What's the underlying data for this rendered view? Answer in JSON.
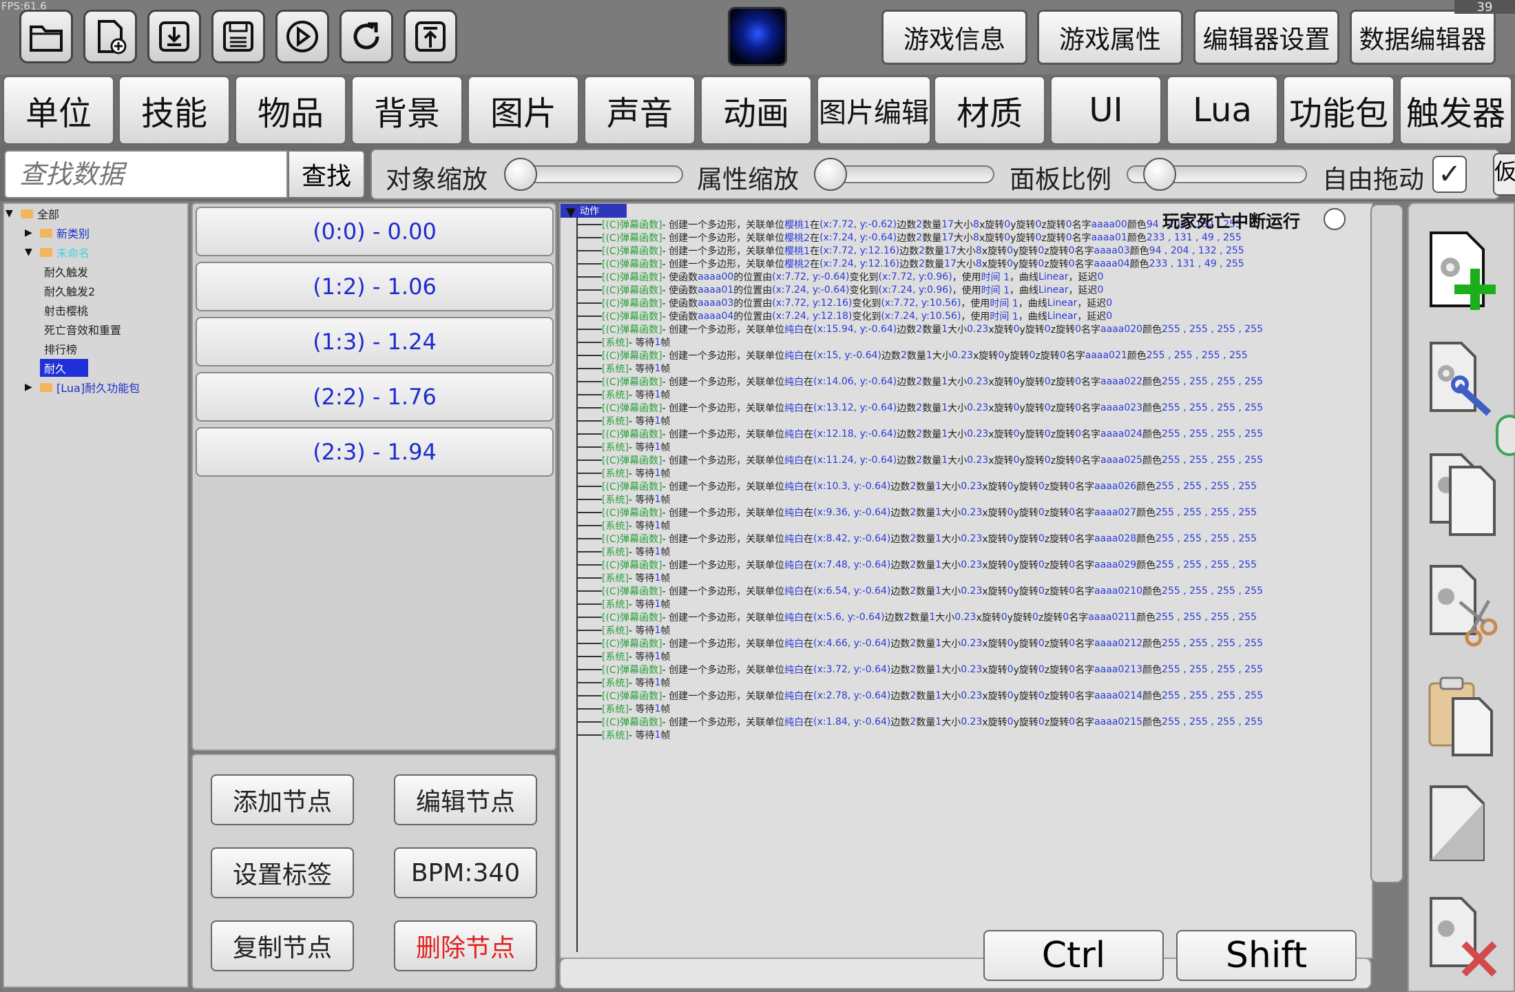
{
  "topbar": {
    "fps": "FPS:61.6",
    "counter": "39",
    "tools": [
      "folder-icon",
      "new-file-icon",
      "download-icon",
      "save-icon",
      "play-icon",
      "refresh-icon",
      "upload-icon"
    ],
    "tabs": [
      "游戏信息",
      "游戏属性",
      "编辑器设置",
      "数据编辑器"
    ]
  },
  "categories": [
    "单位",
    "技能",
    "物品",
    "背景",
    "图片",
    "声音",
    "动画",
    "图片编辑",
    "材质",
    "UI",
    "Lua",
    "功能包",
    "触发器"
  ],
  "search": {
    "placeholder": "查找数据",
    "button": "查找"
  },
  "sliders": {
    "object_scale": "对象缩放",
    "attr_scale": "属性缩放",
    "panel_ratio": "面板比例",
    "free_drag": "自由拖动",
    "check": "✓",
    "edge": "仮"
  },
  "tree": {
    "root": "全部",
    "items": [
      "新类别",
      "未命名",
      "耐久触发",
      "耐久触发2",
      "射击樱桃",
      "死亡音效和重置",
      "排行榜",
      "耐久",
      "[Lua]耐久功能包"
    ]
  },
  "nodes": [
    "(0:0) - 0.00",
    "(1:2) - 1.06",
    "(1:3) - 1.24",
    "(2:2) - 1.76",
    "(2:3) - 1.94"
  ],
  "node_buttons": {
    "add": "添加节点",
    "edit": "编辑节点",
    "tag": "设置标签",
    "bpm": "BPM:340",
    "copy": "复制节点",
    "delete": "删除节点"
  },
  "actions": {
    "header": "动作",
    "pause_label": "玩家死亡中断运行",
    "tag_barrage": "[(C)弹幕函数]",
    "tag_system": "[系统]",
    "wait_text": " - 等待 ",
    "wait_value": "1",
    "wait_unit": " 帧",
    "rows": [
      {
        "kind": "create",
        "unit": "樱桃1",
        "pos": "(x:7.72, y:-0.62)",
        "edges": "2",
        "count": "17",
        "size": "8",
        "name": "aaaa00",
        "color": "94 , 204 , 132 , 255"
      },
      {
        "kind": "create",
        "unit": "樱桃2",
        "pos": "(x:7.24, y:-0.64)",
        "edges": "2",
        "count": "17",
        "size": "8",
        "name": "aaaa01",
        "color": "233 , 131 , 49 , 255"
      },
      {
        "kind": "create",
        "unit": "樱桃1",
        "pos": "(x:7.72, y:12.16)",
        "edges": "2",
        "count": "17",
        "size": "8",
        "name": "aaaa03",
        "color": "94 , 204 , 132 , 255"
      },
      {
        "kind": "create",
        "unit": "樱桃2",
        "pos": "(x:7.24, y:12.16)",
        "edges": "2",
        "count": "17",
        "size": "8",
        "name": "aaaa04",
        "color": "233 , 131 , 49 , 255"
      },
      {
        "kind": "move",
        "name": "aaaa00",
        "from": "(x:7.72, y:-0.64)",
        "to": "(x:7.72, y:0.96)"
      },
      {
        "kind": "move",
        "name": "aaaa01",
        "from": "(x:7.24, y:-0.64)",
        "to": "(x:7.24, y:0.96)"
      },
      {
        "kind": "move",
        "name": "aaaa03",
        "from": "(x:7.72, y:12.16)",
        "to": "(x:7.72, y:10.56)"
      },
      {
        "kind": "move",
        "name": "aaaa04",
        "from": "(x:7.24, y:12.18)",
        "to": "(x:7.24, y:10.56)"
      },
      {
        "kind": "create",
        "unit": "纯白",
        "pos": "(x:15.94, y:-0.64)",
        "edges": "2",
        "count": "1",
        "size": "0.23",
        "name": "aaaa020",
        "color": "255 , 255 , 255 , 255"
      },
      {
        "kind": "wait"
      },
      {
        "kind": "create",
        "unit": "纯白",
        "pos": "(x:15, y:-0.64)",
        "edges": "2",
        "count": "1",
        "size": "0.23",
        "name": "aaaa021",
        "color": "255 , 255 , 255 , 255"
      },
      {
        "kind": "wait"
      },
      {
        "kind": "create",
        "unit": "纯白",
        "pos": "(x:14.06, y:-0.64)",
        "edges": "2",
        "count": "1",
        "size": "0.23",
        "name": "aaaa022",
        "color": "255 , 255 , 255 , 255"
      },
      {
        "kind": "wait"
      },
      {
        "kind": "create",
        "unit": "纯白",
        "pos": "(x:13.12, y:-0.64)",
        "edges": "2",
        "count": "1",
        "size": "0.23",
        "name": "aaaa023",
        "color": "255 , 255 , 255 , 255"
      },
      {
        "kind": "wait"
      },
      {
        "kind": "create",
        "unit": "纯白",
        "pos": "(x:12.18, y:-0.64)",
        "edges": "2",
        "count": "1",
        "size": "0.23",
        "name": "aaaa024",
        "color": "255 , 255 , 255 , 255"
      },
      {
        "kind": "wait"
      },
      {
        "kind": "create",
        "unit": "纯白",
        "pos": "(x:11.24, y:-0.64)",
        "edges": "2",
        "count": "1",
        "size": "0.23",
        "name": "aaaa025",
        "color": "255 , 255 , 255 , 255"
      },
      {
        "kind": "wait"
      },
      {
        "kind": "create",
        "unit": "纯白",
        "pos": "(x:10.3, y:-0.64)",
        "edges": "2",
        "count": "1",
        "size": "0.23",
        "name": "aaaa026",
        "color": "255 , 255 , 255 , 255"
      },
      {
        "kind": "wait"
      },
      {
        "kind": "create",
        "unit": "纯白",
        "pos": "(x:9.36, y:-0.64)",
        "edges": "2",
        "count": "1",
        "size": "0.23",
        "name": "aaaa027",
        "color": "255 , 255 , 255 , 255"
      },
      {
        "kind": "wait"
      },
      {
        "kind": "create",
        "unit": "纯白",
        "pos": "(x:8.42, y:-0.64)",
        "edges": "2",
        "count": "1",
        "size": "0.23",
        "name": "aaaa028",
        "color": "255 , 255 , 255 , 255"
      },
      {
        "kind": "wait"
      },
      {
        "kind": "create",
        "unit": "纯白",
        "pos": "(x:7.48, y:-0.64)",
        "edges": "2",
        "count": "1",
        "size": "0.23",
        "name": "aaaa029",
        "color": "255 , 255 , 255 , 255"
      },
      {
        "kind": "wait"
      },
      {
        "kind": "create",
        "unit": "纯白",
        "pos": "(x:6.54, y:-0.64)",
        "edges": "2",
        "count": "1",
        "size": "0.23",
        "name": "aaaa0210",
        "color": "255 , 255 , 255 , 255"
      },
      {
        "kind": "wait"
      },
      {
        "kind": "create",
        "unit": "纯白",
        "pos": "(x:5.6, y:-0.64)",
        "edges": "2",
        "count": "1",
        "size": "0.23",
        "name": "aaaa0211",
        "color": "255 , 255 , 255 , 255"
      },
      {
        "kind": "wait"
      },
      {
        "kind": "create",
        "unit": "纯白",
        "pos": "(x:4.66, y:-0.64)",
        "edges": "2",
        "count": "1",
        "size": "0.23",
        "name": "aaaa0212",
        "color": "255 , 255 , 255 , 255"
      },
      {
        "kind": "wait"
      },
      {
        "kind": "create",
        "unit": "纯白",
        "pos": "(x:3.72, y:-0.64)",
        "edges": "2",
        "count": "1",
        "size": "0.23",
        "name": "aaaa0213",
        "color": "255 , 255 , 255 , 255"
      },
      {
        "kind": "wait"
      },
      {
        "kind": "create",
        "unit": "纯白",
        "pos": "(x:2.78, y:-0.64)",
        "edges": "2",
        "count": "1",
        "size": "0.23",
        "name": "aaaa0214",
        "color": "255 , 255 , 255 , 255"
      },
      {
        "kind": "wait"
      },
      {
        "kind": "create",
        "unit": "纯白",
        "pos": "(x:1.84, y:-0.64)",
        "edges": "2",
        "count": "1",
        "size": "0.23",
        "name": "aaaa0215",
        "color": "255 , 255 , 255 , 255"
      },
      {
        "kind": "wait"
      }
    ]
  },
  "keys": {
    "ctrl": "Ctrl",
    "shift": "Shift"
  },
  "right_icons": [
    "add-data-icon",
    "edit-data-icon",
    "copy-data-icon",
    "cut-data-icon",
    "paste-data-icon",
    "blank-data-icon",
    "delete-data-icon"
  ]
}
